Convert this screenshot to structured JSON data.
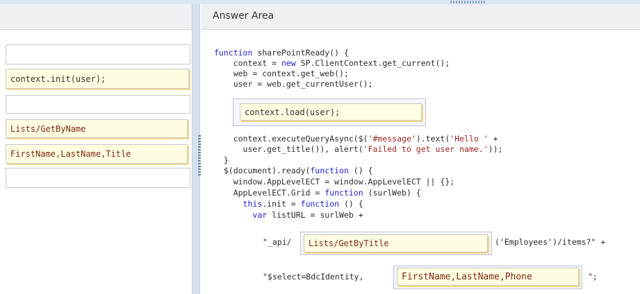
{
  "header": {
    "answer_area_title": "Answer Area"
  },
  "source_options": [
    {
      "label": ""
    },
    {
      "label": "context.init(user);"
    },
    {
      "label": ""
    },
    {
      "label": "Lists/GetByName"
    },
    {
      "label": "FirstName,LastName,Title"
    },
    {
      "label": ""
    }
  ],
  "code": {
    "l1_kw": "function",
    "l1_rest": " sharePointReady() {",
    "l2_pre": "    context = ",
    "l2_kw": "new",
    "l2_rest": " SP.ClientContext.get_current();",
    "l3": "    web = context.get_web();",
    "l4": "    user = web.get_currentUser();",
    "l5_pre": "    context.executeQueryAsync($(",
    "l5_str1": "'#message'",
    "l5_mid": ").text(",
    "l5_str2": "'Hello '",
    "l5_end": " +",
    "l6_pre": "      user.get_title()), alert(",
    "l6_str": "'Failed to get user name.'",
    "l6_end": "));",
    "l7": "  }",
    "l8_pre": "  $(document).ready(",
    "l8_kw": "function",
    "l8_rest": " () {",
    "l9": "    window.AppLevelECT = window.AppLevelECT || {};",
    "l10_pre": "    AppLevelECT.Grid = ",
    "l10_kw": "function",
    "l10_rest": " (surlWeb) {",
    "l11_pre": "      ",
    "l11_kw1": "this",
    "l11_mid": ".init = ",
    "l11_kw2": "function",
    "l11_rest": " () {",
    "l12_pre": "        ",
    "l12_kw": "var",
    "l12_rest": " listURL = surlWeb +",
    "l13_str": "\"_api/",
    "l13_after": "('Employees')/items?\" +",
    "l14_str": "\"$select=BdcIdentity,",
    "l14_after": "\";"
  },
  "answer_slots": {
    "slot1": "context.load(user);",
    "slot2": "Lists/GetByTitle",
    "slot3": "FirstName,LastName,Phone"
  }
}
